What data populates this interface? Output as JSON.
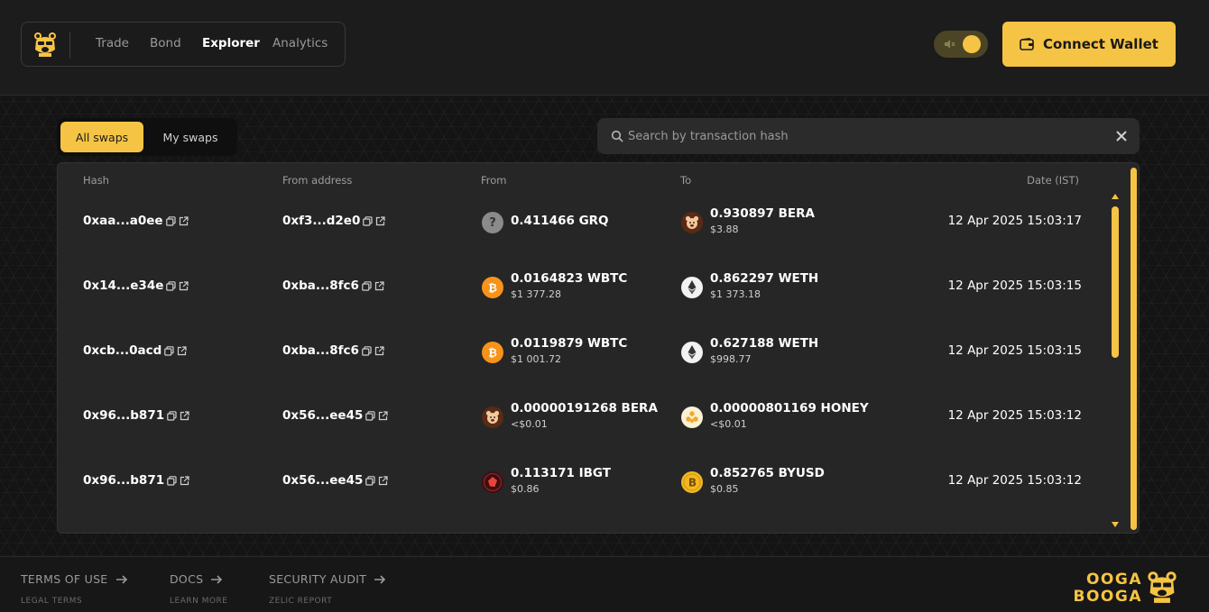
{
  "header": {
    "logo_icon": "bear-logo-icon",
    "nav": [
      "Trade",
      "Bond",
      "Explorer",
      "Analytics"
    ],
    "active_nav": "Explorer",
    "sound_toggle_icon": "speaker-muted-icon",
    "connect_wallet_label": "Connect Wallet",
    "connect_wallet_icon": "wallet-icon"
  },
  "tabs": {
    "all_swaps": "All swaps",
    "my_swaps": "My swaps",
    "active": "All swaps"
  },
  "search": {
    "placeholder": "Search by transaction hash",
    "value": ""
  },
  "table": {
    "columns": {
      "hash": "Hash",
      "from_address": "From address",
      "from": "From",
      "to": "To",
      "date": "Date (IST)"
    },
    "rows": [
      {
        "hash": "0xaa...a0ee",
        "from_address": "0xf3...d2e0",
        "from_amount": "0.411466 GRQ",
        "from_usd": "",
        "from_icon": "unknown-token-icon",
        "to_amount": "0.930897 BERA",
        "to_usd": "$3.88",
        "to_icon": "bera-token-icon",
        "date": "12 Apr 2025 15:03:17"
      },
      {
        "hash": "0x14...e34e",
        "from_address": "0xba...8fc6",
        "from_amount": "0.0164823 WBTC",
        "from_usd": "$1 377.28",
        "from_icon": "wbtc-token-icon",
        "to_amount": "0.862297 WETH",
        "to_usd": "$1 373.18",
        "to_icon": "weth-token-icon",
        "date": "12 Apr 2025 15:03:15"
      },
      {
        "hash": "0xcb...0acd",
        "from_address": "0xba...8fc6",
        "from_amount": "0.0119879 WBTC",
        "from_usd": "$1 001.72",
        "from_icon": "wbtc-token-icon",
        "to_amount": "0.627188 WETH",
        "to_usd": "$998.77",
        "to_icon": "weth-token-icon",
        "date": "12 Apr 2025 15:03:15"
      },
      {
        "hash": "0x96...b871",
        "from_address": "0x56...ee45",
        "from_amount": "0.00000191268 BERA",
        "from_usd": "<$0.01",
        "from_icon": "bera-token-icon",
        "to_amount": "0.00000801169 HONEY",
        "to_usd": "<$0.01",
        "to_icon": "honey-token-icon",
        "date": "12 Apr 2025 15:03:12"
      },
      {
        "hash": "0x96...b871",
        "from_address": "0x56...ee45",
        "from_amount": "0.113171 IBGT",
        "from_usd": "$0.86",
        "from_icon": "ibgt-token-icon",
        "to_amount": "0.852765 BYUSD",
        "to_usd": "$0.85",
        "to_icon": "byusd-token-icon",
        "date": "12 Apr 2025 15:03:12"
      }
    ]
  },
  "footer": {
    "links": [
      {
        "label": "TERMS OF USE",
        "sub": "LEGAL TERMS"
      },
      {
        "label": "DOCS",
        "sub": "LEARN MORE"
      },
      {
        "label": "SECURITY AUDIT",
        "sub": "ZELIC REPORT"
      }
    ],
    "brand_line1": "OOGA",
    "brand_line2": "BOOGA"
  },
  "colors": {
    "accent": "#f6c444",
    "background": "#171717",
    "panel": "#262626"
  }
}
